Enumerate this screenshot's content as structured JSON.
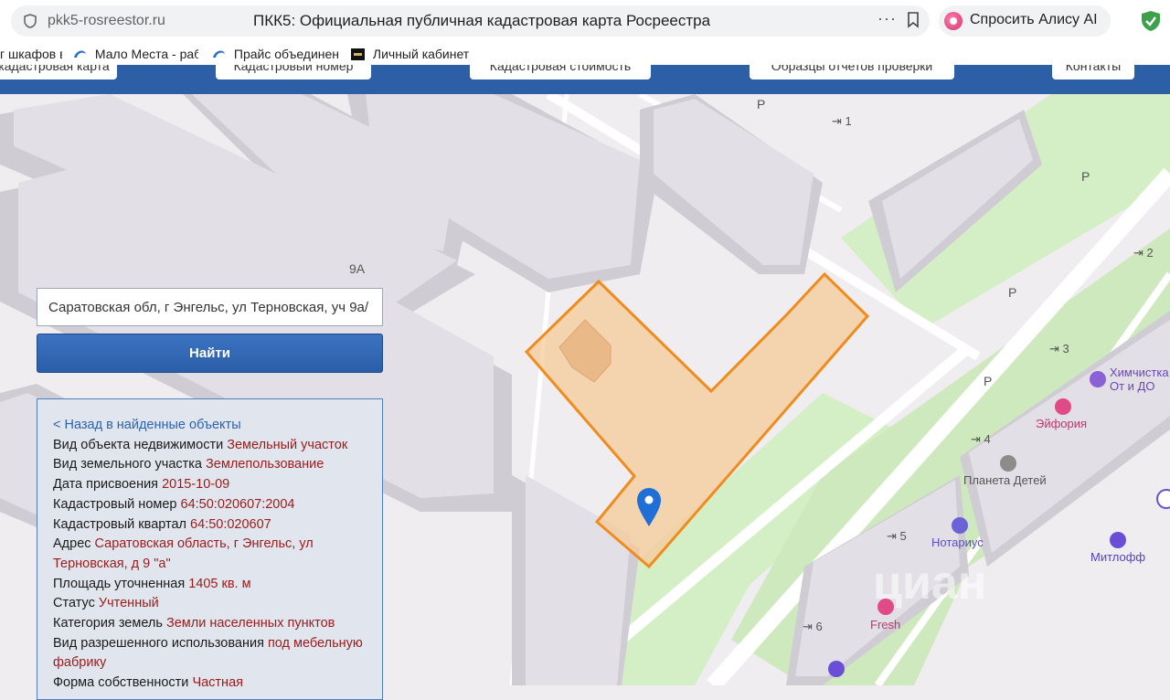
{
  "browser": {
    "domain": "pkk5-rosreestor.ru",
    "title": "ПКК5: Официальная публичная кадастровая карта Росреестра",
    "more": "···",
    "alice": "Спросить Алису AI"
  },
  "bookmarks": [
    {
      "label": "г шкафов в"
    },
    {
      "label": "Мало Места - раб"
    },
    {
      "label": "Прайс объединен"
    },
    {
      "label": "Личный кабинет"
    }
  ],
  "site_nav": [
    "кадастровая карта",
    "Кадастровый номер",
    "Кадастровая стоимость",
    "Образцы отчетов проверки",
    "Контакты"
  ],
  "map": {
    "building_label": "9А",
    "parking": "P",
    "entrances": [
      "1",
      "2",
      "3",
      "4",
      "5",
      "6"
    ],
    "pois": {
      "khimchistka": "Химчистка\nОт и ДО",
      "euphoria": "Эйфория",
      "planeta": "Планета Детей",
      "notarius": "Нотариус",
      "mitloff": "Митлофф",
      "fresh": "Fresh"
    },
    "watermark": "циан",
    "colors": {
      "parcel_fill": "#f6c99a",
      "parcel_stroke": "#f08c1e",
      "marker": "#1f6fd6",
      "park": "#d4efc5"
    }
  },
  "search": {
    "value": "Саратовская обл, г Энгельс, ул Терновская, уч 9а/",
    "button": "Найти"
  },
  "info": {
    "back": "< Назад в найденные объекты",
    "rows": [
      {
        "k": "Вид объекта недвижимости",
        "v": "Земельный участок"
      },
      {
        "k": "Вид земельного участка",
        "v": "Землепользование"
      },
      {
        "k": "Дата присвоения",
        "v": "2015-10-09"
      },
      {
        "k": "Кадастровый номер",
        "v": "64:50:020607:2004"
      },
      {
        "k": "Кадастровый квартал",
        "v": "64:50:020607"
      },
      {
        "k": "Адрес",
        "v": "Саратовская область, г Энгельс, ул Терновская, д 9 \"а\""
      },
      {
        "k": "Площадь уточненная",
        "v": "1405 кв. м"
      },
      {
        "k": "Статус",
        "v": "Учтенный"
      },
      {
        "k": "Категория земель",
        "v": "Земли населенных пунктов"
      },
      {
        "k": "Вид разрешенного использования",
        "v": "под мебельную фабрику"
      },
      {
        "k": "Форма собственности",
        "v": "Частная"
      }
    ]
  }
}
